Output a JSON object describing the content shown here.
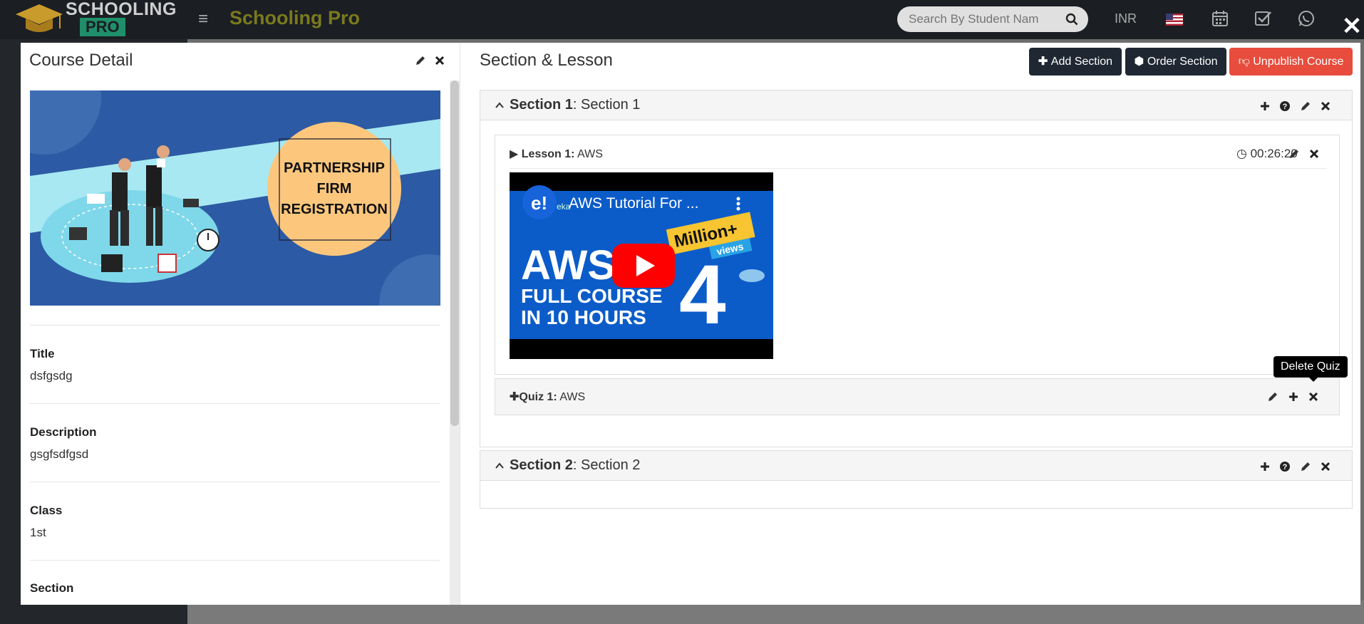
{
  "header": {
    "logo_line1": "SCHOOLING",
    "logo_line2": "PRO",
    "app_title": "Schooling Pro",
    "search_placeholder": "Search By Student Nam",
    "currency": "INR"
  },
  "course_detail": {
    "title": "Course Detail",
    "banner": {
      "line1": "PARTNERSHIP",
      "line2": "FIRM",
      "line3": "REGISTRATION"
    },
    "fields": [
      {
        "label": "Title",
        "value": "dsfgsdg"
      },
      {
        "label": "Description",
        "value": "gsgfsdfgsd"
      },
      {
        "label": "Class",
        "value": "1st"
      },
      {
        "label": "Section",
        "value": ""
      }
    ]
  },
  "section_lesson": {
    "title": "Section & Lesson",
    "buttons": {
      "add_section": "Add Section",
      "order_section": "Order Section",
      "unpublish": "Unpublish Course"
    },
    "sections": [
      {
        "label": "Section 1",
        "name": ": Section 1",
        "lesson": {
          "label": "Lesson 1:",
          "name": " AWS",
          "duration": "00:26:20",
          "video": {
            "title": "AWS Tutorial For ...",
            "big1": "AWS",
            "big2": "FULL COURSE",
            "big3": "IN 10 HOURS",
            "badge": "Million+",
            "badge_sub": "views",
            "number": "4",
            "channel_letter": "e!",
            "channel_text": "eka"
          }
        },
        "quiz": {
          "label": "Quiz 1:",
          "name": " AWS"
        }
      },
      {
        "label": "Section 2",
        "name": ": Section 2"
      }
    ],
    "tooltip": "Delete Quiz"
  },
  "colors": {
    "accent_dark": "#1f2733",
    "danger": "#e74c3c",
    "brand_green": "#1f8f6a"
  }
}
